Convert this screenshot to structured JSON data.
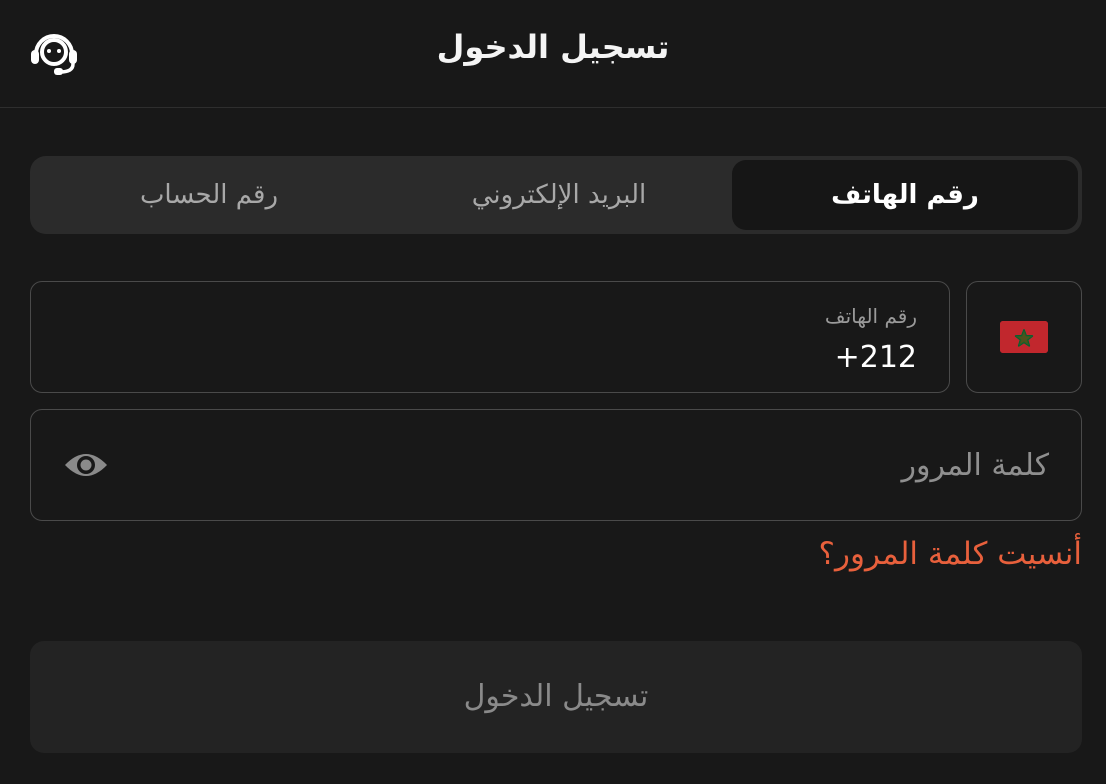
{
  "header": {
    "title": "تسجيل الدخول",
    "support_icon": "headset-icon"
  },
  "tabs": [
    {
      "label": "رقم الهاتف",
      "active": true
    },
    {
      "label": "البريد الإلكتروني",
      "active": false
    },
    {
      "label": "رقم الحساب",
      "active": false
    }
  ],
  "phone": {
    "country_flag_icon": "morocco-flag-icon",
    "label": "رقم الهاتف",
    "value": "+212"
  },
  "password": {
    "placeholder": "كلمة المرور",
    "toggle_icon": "eye-icon"
  },
  "forgot_link": "أنسيت كلمة المرور؟",
  "login_button": "تسجيل الدخول",
  "colors": {
    "background": "#181818",
    "accent_link": "#e8603c",
    "flag_red": "#c1272d",
    "flag_star": "#006233"
  }
}
